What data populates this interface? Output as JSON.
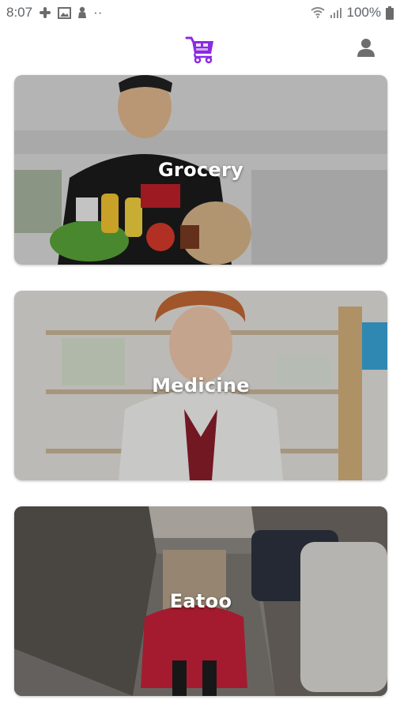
{
  "status_bar": {
    "time": "8:07",
    "left_icons": [
      "slack-icon",
      "image-icon",
      "person-icon"
    ],
    "more": "··",
    "battery": "100%",
    "right_icons": [
      "wifi-icon",
      "signal-icon",
      "battery-icon"
    ]
  },
  "header": {
    "logo_icon": "shopping-cart-logo-icon",
    "profile_icon": "user-profile-icon",
    "accent_color": "#8a2be2"
  },
  "cards": [
    {
      "label": "Grocery"
    },
    {
      "label": "Medicine"
    },
    {
      "label": "Eatoo"
    }
  ]
}
